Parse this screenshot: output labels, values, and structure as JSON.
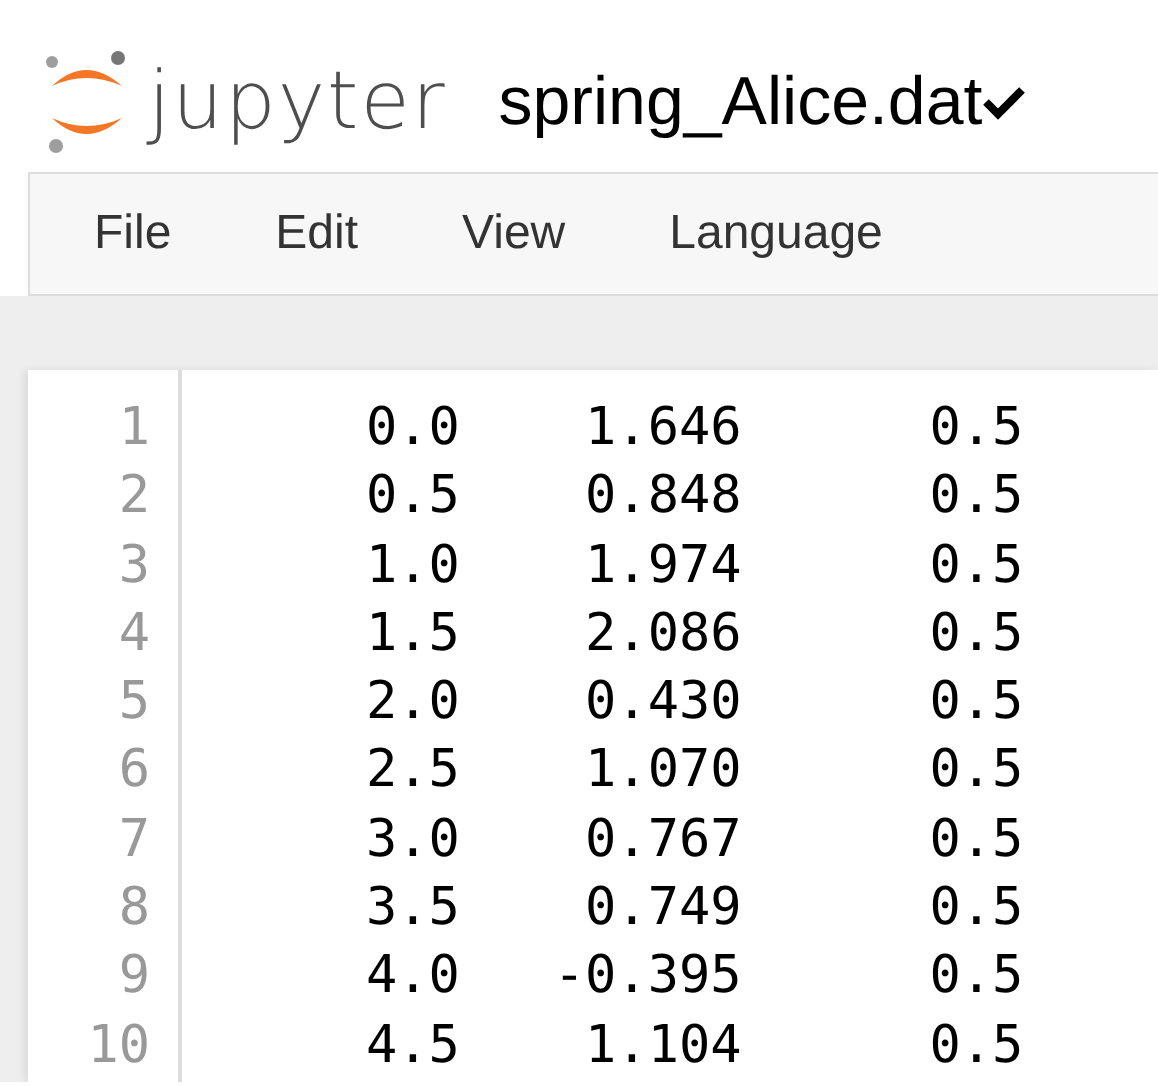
{
  "header": {
    "logo_text": "jupyter",
    "title": "spring_Alice.dat",
    "saved": true
  },
  "menu": [
    "File",
    "Edit",
    "View",
    "Language"
  ],
  "editor": {
    "lines": [
      {
        "number": "1",
        "text": "   0.0    1.646      0.5"
      },
      {
        "number": "2",
        "text": "   0.5    0.848      0.5"
      },
      {
        "number": "3",
        "text": "   1.0    1.974      0.5"
      },
      {
        "number": "4",
        "text": "   1.5    2.086      0.5"
      },
      {
        "number": "5",
        "text": "   2.0    0.430      0.5"
      },
      {
        "number": "6",
        "text": "   2.5    1.070      0.5"
      },
      {
        "number": "7",
        "text": "   3.0    0.767      0.5"
      },
      {
        "number": "8",
        "text": "   3.5    0.749      0.5"
      },
      {
        "number": "9",
        "text": "   4.0   -0.395      0.5"
      },
      {
        "number": "10",
        "text": "   4.5    1.104      0.5"
      }
    ]
  }
}
